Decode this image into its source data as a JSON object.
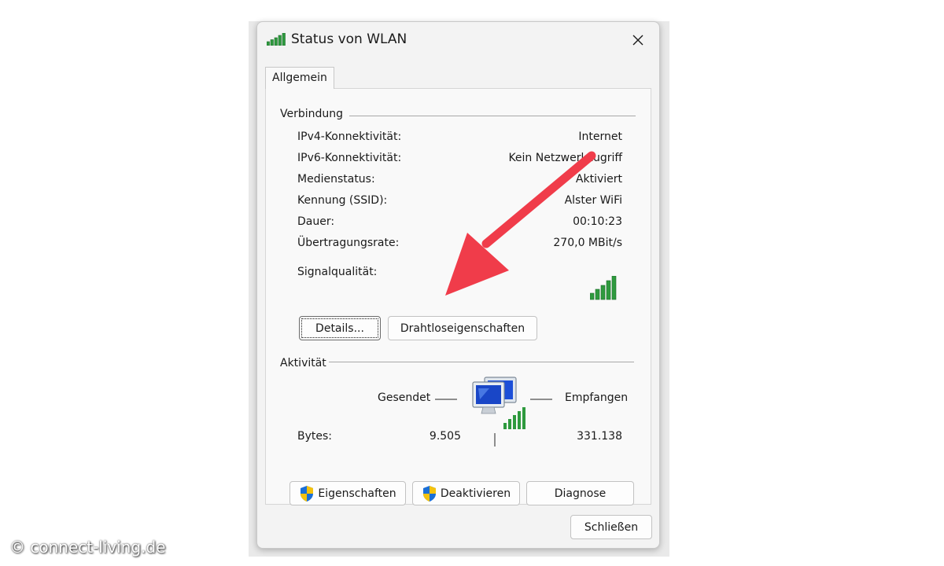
{
  "window": {
    "title": "Status von WLAN",
    "close_icon": "close-icon"
  },
  "tabs": [
    {
      "label": "Allgemein",
      "selected": true
    }
  ],
  "connection": {
    "group_label": "Verbindung",
    "rows": [
      {
        "label": "IPv4-Konnektivität:",
        "value": "Internet"
      },
      {
        "label": "IPv6-Konnektivität:",
        "value": "Kein Netzwerkzugriff"
      },
      {
        "label": "Medienstatus:",
        "value": "Aktiviert"
      },
      {
        "label": "Kennung (SSID):",
        "value": "Alster WiFi"
      },
      {
        "label": "Dauer:",
        "value": "00:10:23"
      },
      {
        "label": "Übertragungsrate:",
        "value": "270,0 MBit/s"
      }
    ],
    "signal_label": "Signalqualität:",
    "signal_bars": 5,
    "details_button": "Details...",
    "wireless_button": "Drahtloseigenschaften"
  },
  "activity": {
    "group_label": "Aktivität",
    "sent_label": "Gesendet",
    "received_label": "Empfangen",
    "bytes_label": "Bytes:",
    "bytes_sent": "9.505",
    "bytes_received": "331.138"
  },
  "actions": {
    "properties_button": "Eigenschaften",
    "deactivate_button": "Deaktivieren",
    "diagnose_button": "Diagnose"
  },
  "footer": {
    "close_button": "Schließen"
  },
  "watermark": "© connect-living.de",
  "colors": {
    "arrow": "#f03c4a",
    "signal_green": "#2e9a3e",
    "shield_blue": "#1a6fd6",
    "shield_yellow": "#f4c20d"
  }
}
